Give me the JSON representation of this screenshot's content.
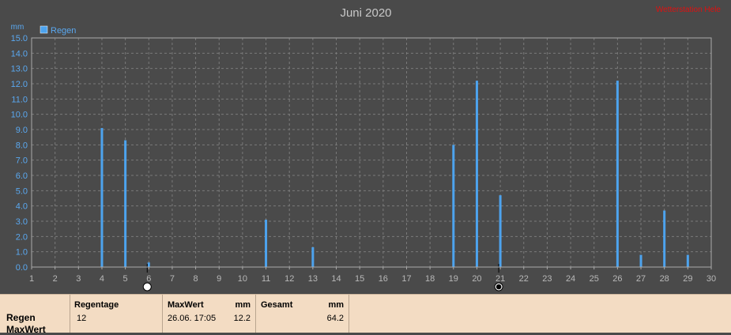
{
  "title": "Juni 2020",
  "watermark": "Wetterstation Hele",
  "colors": {
    "background": "#4a4a4a",
    "plot_border": "#aaaaaa",
    "grid": "#7a7a7a",
    "bar": "#4da3ee",
    "axis_text": "#b8b8b8",
    "y_text": "#5aa8f0",
    "title_text": "#c8c8c8",
    "watermark": "#e01010"
  },
  "chart_data": {
    "type": "bar",
    "title": "Juni 2020",
    "ylabel": "mm",
    "ylim": [
      0,
      15
    ],
    "y_ticks": [
      "0.0",
      "1.0",
      "2.0",
      "3.0",
      "4.0",
      "5.0",
      "6.0",
      "7.0",
      "8.0",
      "9.0",
      "10.0",
      "11.0",
      "12.0",
      "13.0",
      "14.0",
      "15.0"
    ],
    "x_ticks": [
      "1",
      "2",
      "3",
      "4",
      "5",
      "6",
      "7",
      "8",
      "9",
      "10",
      "11",
      "12",
      "13",
      "14",
      "15",
      "16",
      "17",
      "18",
      "19",
      "20",
      "21",
      "22",
      "23",
      "24",
      "25",
      "26",
      "27",
      "28",
      "29",
      "30"
    ],
    "xlim": [
      1,
      30
    ],
    "grid": true,
    "legend_position": "top-left",
    "series": [
      {
        "name": "Regen",
        "x": [
          4,
          5,
          6,
          11,
          13,
          19,
          20,
          21,
          26,
          27,
          28,
          29
        ],
        "values": [
          9.1,
          8.3,
          0.3,
          3.1,
          1.3,
          8.0,
          12.2,
          4.7,
          12.2,
          0.8,
          3.7,
          0.8
        ]
      }
    ],
    "moon_markers": [
      {
        "x": 6,
        "icon": "full-moon-icon"
      },
      {
        "x": 21,
        "icon": "new-moon-icon"
      }
    ]
  },
  "summary": {
    "row_labels": [
      "Regen",
      "MaxWert"
    ],
    "regentage_header": "Regentage",
    "regentage_value": "12",
    "maxwert_header": "MaxWert",
    "maxwert_unit": "mm",
    "maxwert_time": "26.06.  17:05",
    "maxwert_value": "12.2",
    "gesamt_header": "Gesamt",
    "gesamt_unit": "mm",
    "gesamt_value": "64.2"
  }
}
